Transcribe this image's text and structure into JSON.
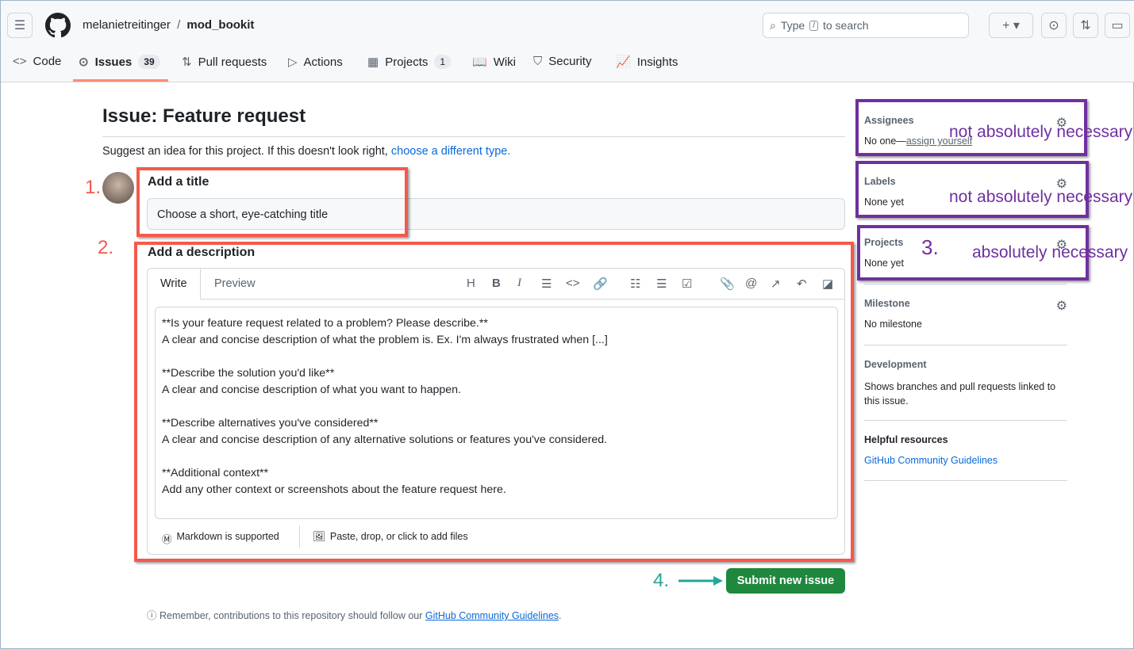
{
  "header": {
    "owner": "melanietreitinger",
    "separator": "/",
    "repo": "mod_bookit",
    "search_placeholder_pre": "Type",
    "search_key": "/",
    "search_placeholder_post": "to search"
  },
  "tabs": [
    {
      "label": "Code",
      "icon": "code-icon"
    },
    {
      "label": "Issues",
      "count": "39",
      "icon": "issue-icon",
      "active": true
    },
    {
      "label": "Pull requests",
      "icon": "pull-request-icon"
    },
    {
      "label": "Actions",
      "icon": "play-icon"
    },
    {
      "label": "Projects",
      "count": "1",
      "icon": "table-icon"
    },
    {
      "label": "Wiki",
      "icon": "book-icon"
    },
    {
      "label": "Security",
      "icon": "shield-icon"
    },
    {
      "label": "Insights",
      "icon": "graph-icon"
    }
  ],
  "main": {
    "title": "Issue: Feature request",
    "subtitle": "Suggest an idea for this project. If this doesn't look right,",
    "subtitle_link": "choose a different type.",
    "title_label": "Add a title",
    "title_placeholder": "Choose a short, eye-catching title",
    "desc_label": "Add a description",
    "write_tab": "Write",
    "preview_tab": "Preview",
    "body": "**Is your feature request related to a problem? Please describe.**\nA clear and concise description of what the problem is. Ex. I'm always frustrated when [...]\n\n**Describe the solution you'd like**\nA clear and concise description of what you want to happen.\n\n**Describe alternatives you've considered**\nA clear and concise description of any alternative solutions or features you've considered.\n\n**Additional context**\nAdd any other context or screenshots about the feature request here.",
    "markdown_note": "Markdown is supported",
    "files_note": "Paste, drop, or click to add files",
    "submit": "Submit new issue",
    "footer_pre": "Remember, contributions to this repository should follow our",
    "footer_link": "GitHub Community Guidelines",
    "footer_post": "."
  },
  "sidebar": {
    "assignees": {
      "label": "Assignees",
      "value": "No one—",
      "link": "assign yourself"
    },
    "labels": {
      "label": "Labels",
      "value": "None yet"
    },
    "projects": {
      "label": "Projects",
      "value": "None yet"
    },
    "milestone": {
      "label": "Milestone",
      "value": "No milestone"
    },
    "development": {
      "label": "Development",
      "value": "Shows branches and pull requests linked to this issue."
    },
    "resources": {
      "label": "Helpful resources",
      "link": "GitHub Community Guidelines"
    }
  },
  "annotations": {
    "n1": "1.",
    "n2": "2.",
    "n3": "3.",
    "n4": "4.",
    "assignees_note": "not absolutely necessary",
    "labels_note": "not absolutely necessary",
    "projects_note": "absolutely necessary"
  },
  "colors": {
    "accent": "#0969da",
    "submit": "#1f883d",
    "annotation_red": "#f4594c",
    "annotation_purple": "#7030a0",
    "annotation_arrow": "#26a69a"
  }
}
